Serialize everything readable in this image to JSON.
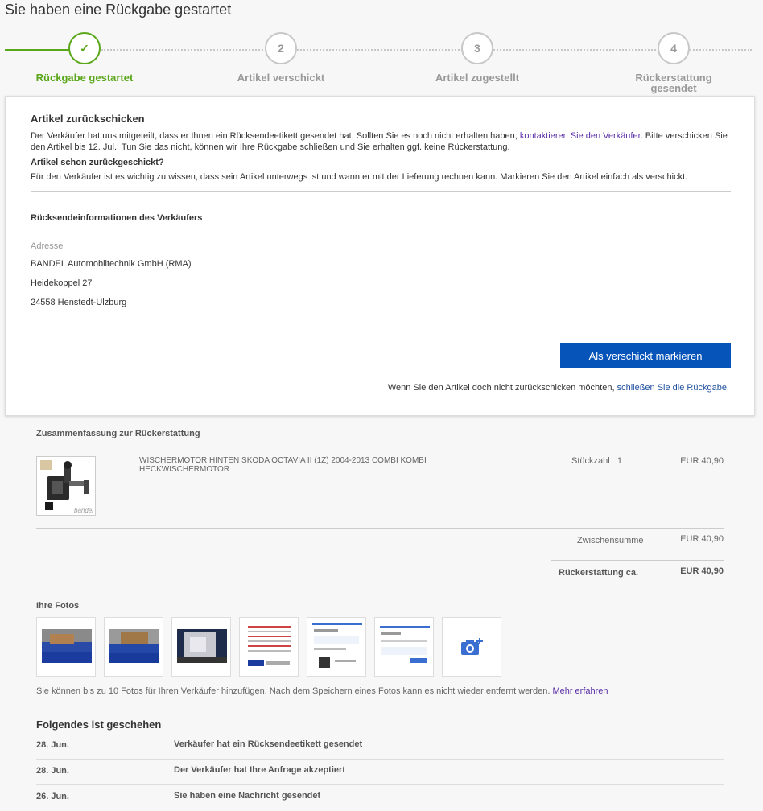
{
  "page": {
    "title": "Sie haben eine Rückgabe gestartet"
  },
  "tracker": {
    "steps": [
      {
        "num": "✓",
        "label": "Rückgabe gestartet",
        "done": true
      },
      {
        "num": "2",
        "label": "Artikel verschickt",
        "done": false
      },
      {
        "num": "3",
        "label": "Artikel zugestellt",
        "done": false
      },
      {
        "num": "4",
        "label": "Rückerstattung gesendet",
        "done": false
      }
    ],
    "colors": {
      "done": "#5ba71b",
      "todo": "#c7c7c7"
    }
  },
  "card": {
    "heading": "Artikel zurückschicken",
    "intro_before_link": "Der Verkäufer hat uns mitgeteilt, dass er Ihnen ein Rücksendeetikett gesendet hat. Sollten Sie es noch nicht erhalten haben,",
    "intro_link": "kontaktieren Sie den Verkäufer",
    "intro_after_link": ". Bitte verschicken Sie den Artikel bis 12. Jul.. Tun Sie das nicht, können wir Ihre Rückgabe schließen und Sie erhalten ggf. keine Rückerstattung.",
    "subheading": "Artikel schon zurückgeschickt?",
    "sub_text": "Für den Verkäufer ist es wichtig zu wissen, dass sein Artikel unterwegs ist und wann er mit der Lieferung rechnen kann. Markieren Sie den Artikel einfach als verschickt.",
    "seller_info_heading": "Rücksendeinformationen des Verkäufers",
    "address_label": "Adresse",
    "address": {
      "name": "BANDEL Automobiltechnik GmbH (RMA)",
      "street": "Heidekoppel 27",
      "city": "24558 Henstedt-Ulzburg"
    },
    "primary_button": "Als verschickt markieren",
    "footer_text": "Wenn Sie den Artikel doch nicht zurückschicken möchten,",
    "footer_link": "schließen Sie die Rückgabe.",
    "button_color": "#0654ba"
  },
  "summary": {
    "heading": "Zusammenfassung zur Rückerstattung",
    "item": {
      "title": "WISCHERMOTOR HINTEN SKODA OCTAVIA II (1Z) 2004-2013 COMBI KOMBI HECKWISCHERMOTOR",
      "qty_label": "Stückzahl",
      "qty": "1",
      "price": "EUR 40,90"
    },
    "subtotal_label": "Zwischensumme",
    "subtotal": "EUR 40,90",
    "refund_label": "Rückerstattung ca.",
    "refund": "EUR 40,90"
  },
  "photos": {
    "heading": "Ihre Fotos",
    "add_photo_icon": "camera-plus-icon",
    "note": "Sie können bis zu 10 Fotos für Ihren Verkäufer hinzufügen. Nach dem Speichern eines Fotos kann es nicht wieder entfernt werden.",
    "note_link": "Mehr erfahren"
  },
  "history": {
    "heading": "Folgendes ist geschehen",
    "rows": [
      {
        "date": "28. Jun.",
        "event": "Verkäufer hat ein Rücksendeetikett gesendet"
      },
      {
        "date": "28. Jun.",
        "event": "Der Verkäufer hat Ihre Anfrage akzeptiert"
      },
      {
        "date": "26. Jun.",
        "event": "Sie haben eine Nachricht gesendet"
      }
    ]
  }
}
